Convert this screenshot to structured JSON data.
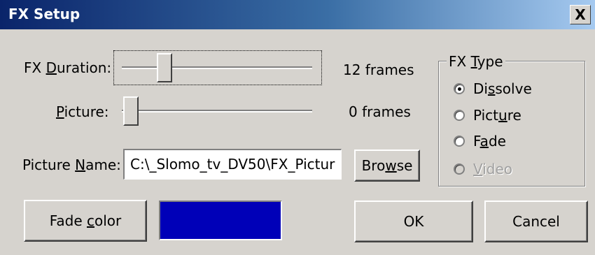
{
  "window": {
    "title": "FX Setup",
    "close_glyph": "X"
  },
  "fx_duration": {
    "label_pre": "FX ",
    "label_key": "D",
    "label_post": "uration:",
    "value_text": "12 frames",
    "slider_fraction": 0.18
  },
  "picture": {
    "label_pre": "",
    "label_key": "P",
    "label_post": "icture:",
    "value_text": "0 frames",
    "slider_fraction": 0.0
  },
  "picture_name": {
    "label_pre": "Picture ",
    "label_key": "N",
    "label_post": "ame:",
    "value": "C:\\_Slomo_tv_DV50\\FX_Pictur"
  },
  "browse_button": {
    "pre": "Bro",
    "key": "w",
    "post": "se"
  },
  "fx_type": {
    "title_pre": "FX ",
    "title_key": "T",
    "title_post": "ype",
    "options": [
      {
        "pre": "Di",
        "key": "s",
        "post": "solve",
        "checked": true,
        "disabled": false
      },
      {
        "pre": "Pict",
        "key": "u",
        "post": "re",
        "checked": false,
        "disabled": false
      },
      {
        "pre": "F",
        "key": "a",
        "post": "de",
        "checked": false,
        "disabled": false
      },
      {
        "pre": "",
        "key": "V",
        "post": "ideo",
        "checked": false,
        "disabled": true
      }
    ]
  },
  "fade_color_button": {
    "pre": "Fade ",
    "key": "c",
    "post": "olor"
  },
  "fade_color_value": "#0000b8",
  "ok_button": {
    "label": "OK"
  },
  "cancel_button": {
    "label": "Cancel"
  },
  "colors": {
    "title_start": "#0a246a",
    "title_end": "#a6caf0",
    "face": "#d6d3ce"
  }
}
